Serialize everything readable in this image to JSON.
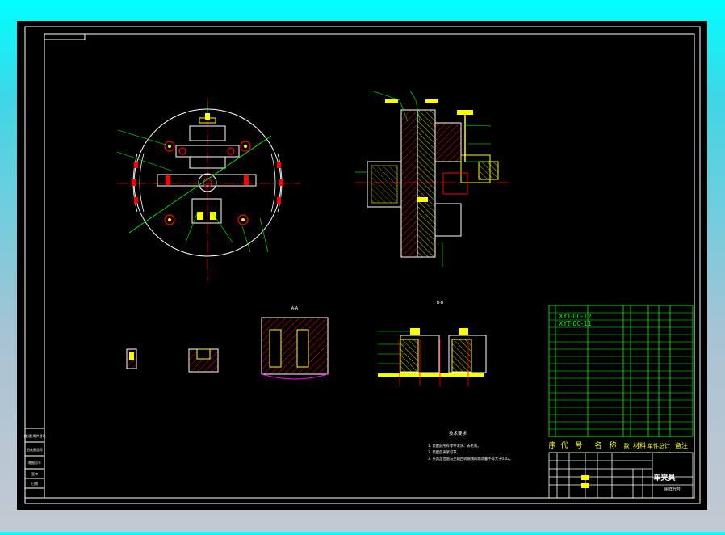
{
  "title_block": {
    "drawing_name": "车夹具",
    "subtitle": "图样代号"
  },
  "parts_list": {
    "header": [
      "序",
      "代　号",
      "名　称",
      "数",
      "材料",
      "单件",
      "总计",
      "备注"
    ],
    "rows": [
      "XYT-00-12",
      "XYT-00-11"
    ]
  },
  "tech_requirements": {
    "title": "技术要求",
    "items": [
      "1. 装配前所有零件清洗、去毛刺。",
      "2. 装配后夹紧可靠。",
      "3. 夹具定位面与主轴回转轴线的跳动量不得大于0.02。"
    ]
  },
  "views": {
    "section_a": "A-A",
    "section_b": "B-B"
  },
  "left_stamp": {
    "cells": [
      "借(通)用件登记",
      "旧底图总号",
      "底图总号",
      "签字",
      "日期"
    ]
  },
  "colors": {
    "background": "#000000",
    "frame": "#ffffff",
    "table": "#00ff00",
    "part": "#ffff00",
    "hatch": "#ff0000",
    "center_line": "#ff0000",
    "leader": "#00ff00",
    "shaded": "#808080"
  }
}
